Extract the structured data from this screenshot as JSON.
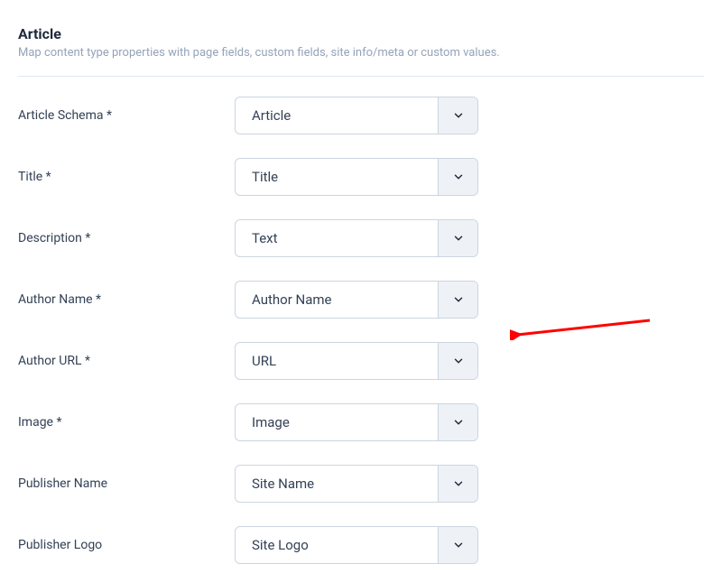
{
  "header": {
    "title": "Article",
    "subtitle": "Map content type properties with page fields, custom fields, site info/meta or custom values."
  },
  "fields": {
    "articleSchema": {
      "label": "Article Schema *",
      "value": "Article"
    },
    "title": {
      "label": "Title *",
      "value": "Title"
    },
    "description": {
      "label": "Description *",
      "value": "Text"
    },
    "authorName": {
      "label": "Author Name *",
      "value": "Author Name"
    },
    "authorUrl": {
      "label": "Author URL *",
      "value": "URL"
    },
    "image": {
      "label": "Image *",
      "value": "Image"
    },
    "publisherName": {
      "label": "Publisher Name",
      "value": "Site Name"
    },
    "publisherLogo": {
      "label": "Publisher Logo",
      "value": "Site Logo"
    }
  }
}
